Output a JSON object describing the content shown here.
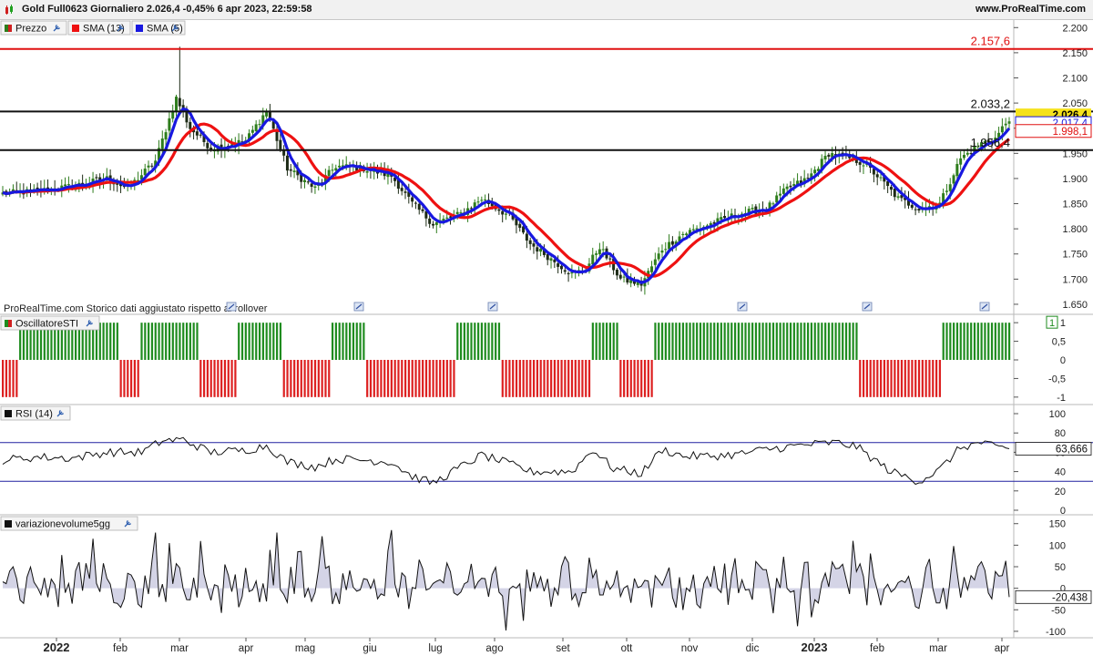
{
  "header": {
    "title": "Gold Full0623 Giornaliero 2.026,4 -0,45% 6 apr 2023, 22:59:58",
    "site": "www.ProRealTime.com"
  },
  "colors": {
    "up_bar": "#2e7d1c",
    "down_bar": "#1d2b16",
    "sma13": "#ee1111",
    "sma5": "#1818e0",
    "sti_up": "#1f8c1f",
    "sti_down": "#dd2020",
    "rsi_band": "#2020a0",
    "vol_fill": "#d4d4e6",
    "last_price_bg": "#f5e21c"
  },
  "chart_data": [
    {
      "type": "candlestick",
      "panel": "price",
      "title": "Prezzo",
      "legend": [
        "Prezzo",
        "SMA (13)",
        "SMA (5)"
      ],
      "y_ticks": [
        2200,
        2150,
        2100,
        2050,
        2000,
        1950,
        1900,
        1850,
        1800,
        1750,
        1700,
        1650
      ],
      "y_tick_labels": [
        "2.200",
        "2.150",
        "2.100",
        "2.050",
        "2.000",
        "1.950",
        "1.900",
        "1.850",
        "1.800",
        "1.750",
        "1.700",
        "1.650"
      ],
      "ylim": [
        1630,
        2215
      ],
      "x_labels": [
        "2022",
        "feb",
        "mar",
        "apr",
        "mag",
        "giu",
        "lug",
        "ago",
        "set",
        "ott",
        "nov",
        "dic",
        "2023",
        "feb",
        "mar",
        "apr"
      ],
      "close_anchors": [
        [
          0,
          1870
        ],
        [
          10,
          1875
        ],
        [
          20,
          1885
        ],
        [
          30,
          1900
        ],
        [
          36,
          1880
        ],
        [
          44,
          1935
        ],
        [
          50,
          2060
        ],
        [
          54,
          2000
        ],
        [
          60,
          1960
        ],
        [
          70,
          1975
        ],
        [
          76,
          2035
        ],
        [
          82,
          1920
        ],
        [
          90,
          1880
        ],
        [
          96,
          1925
        ],
        [
          104,
          1920
        ],
        [
          112,
          1905
        ],
        [
          118,
          1850
        ],
        [
          124,
          1810
        ],
        [
          132,
          1830
        ],
        [
          138,
          1860
        ],
        [
          146,
          1825
        ],
        [
          152,
          1770
        ],
        [
          158,
          1740
        ],
        [
          164,
          1710
        ],
        [
          168,
          1720
        ],
        [
          172,
          1765
        ],
        [
          178,
          1700
        ],
        [
          184,
          1690
        ],
        [
          190,
          1760
        ],
        [
          196,
          1790
        ],
        [
          204,
          1810
        ],
        [
          212,
          1830
        ],
        [
          220,
          1840
        ],
        [
          226,
          1880
        ],
        [
          232,
          1900
        ],
        [
          238,
          1950
        ],
        [
          244,
          1940
        ],
        [
          248,
          1930
        ],
        [
          252,
          1905
        ],
        [
          258,
          1860
        ],
        [
          264,
          1840
        ],
        [
          270,
          1850
        ],
        [
          276,
          1940
        ],
        [
          282,
          1970
        ],
        [
          286,
          1980
        ],
        [
          289,
          2010
        ],
        [
          290,
          2020
        ]
      ],
      "hlines": [
        {
          "value": 2157.6,
          "label": "2.157,6",
          "color": "#e01010"
        },
        {
          "value": 2033.2,
          "label": "2.033,2",
          "color": "#111111"
        },
        {
          "value": 1956.4,
          "label": "1.956,4",
          "color": "#111111"
        }
      ],
      "last_labels": [
        {
          "value": 2026.4,
          "label": "2.026,4"
        },
        {
          "value": 2017.4,
          "label": "2.017,4"
        },
        {
          "value": 1998.1,
          "label": "1.998,1"
        }
      ],
      "note": "ProRealTime.com  Storico dati aggiustato rispetto ai rollover"
    },
    {
      "type": "bar",
      "panel": "sti",
      "title": "OscillatoreSTI",
      "y_ticks": [
        1,
        0.5,
        0,
        -0.5,
        -1
      ],
      "y_tick_labels": [
        "1",
        "0,5",
        "0",
        "-0,5",
        "-1"
      ],
      "ylim": [
        -1.2,
        1.2
      ],
      "values_rule": "+1 when SMA(5) is above SMA(13), -1 otherwise"
    },
    {
      "type": "line",
      "panel": "rsi",
      "title": "RSI (14)",
      "y_ticks": [
        100,
        80,
        60,
        40,
        20,
        0
      ],
      "y_tick_labels": [
        "100",
        "80",
        "60",
        "40",
        "20",
        "0"
      ],
      "ylim": [
        0,
        100
      ],
      "bands": [
        70,
        30
      ],
      "last_value": "63,666",
      "anchors": [
        [
          0,
          52
        ],
        [
          10,
          55
        ],
        [
          20,
          54
        ],
        [
          30,
          60
        ],
        [
          40,
          60
        ],
        [
          46,
          72
        ],
        [
          52,
          73
        ],
        [
          60,
          60
        ],
        [
          70,
          62
        ],
        [
          76,
          67
        ],
        [
          82,
          50
        ],
        [
          90,
          45
        ],
        [
          96,
          53
        ],
        [
          104,
          52
        ],
        [
          112,
          50
        ],
        [
          118,
          35
        ],
        [
          124,
          28
        ],
        [
          132,
          45
        ],
        [
          138,
          57
        ],
        [
          146,
          48
        ],
        [
          152,
          40
        ],
        [
          158,
          40
        ],
        [
          164,
          40
        ],
        [
          170,
          63
        ],
        [
          176,
          43
        ],
        [
          184,
          38
        ],
        [
          190,
          63
        ],
        [
          196,
          56
        ],
        [
          204,
          56
        ],
        [
          212,
          58
        ],
        [
          220,
          63
        ],
        [
          232,
          68
        ],
        [
          240,
          70
        ],
        [
          246,
          66
        ],
        [
          250,
          55
        ],
        [
          256,
          40
        ],
        [
          264,
          30
        ],
        [
          270,
          42
        ],
        [
          276,
          65
        ],
        [
          282,
          70
        ],
        [
          286,
          65
        ],
        [
          290,
          64
        ]
      ]
    },
    {
      "type": "area",
      "panel": "volume",
      "title": "variazionevolume5gg",
      "y_ticks": [
        150,
        100,
        50,
        0,
        -50,
        -100
      ],
      "y_tick_labels": [
        "150",
        "100",
        "50",
        "0",
        "-50",
        "-100"
      ],
      "ylim": [
        -115,
        160
      ],
      "last_value": "-20,438"
    }
  ]
}
